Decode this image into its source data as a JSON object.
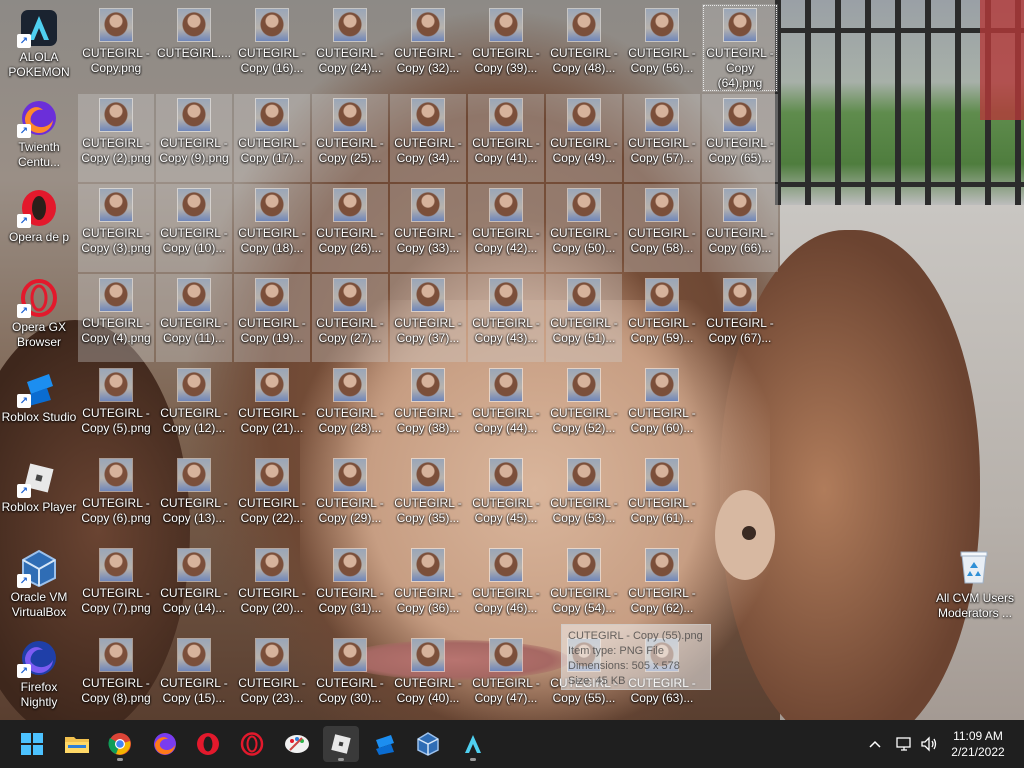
{
  "shortcuts": [
    {
      "label": "ALOLA\nPOKEMON",
      "icon": "alola-pokemon-icon"
    },
    {
      "label": "Twienth\nCentu...",
      "icon": "firefox-icon"
    },
    {
      "label": "Opera de p",
      "icon": "opera-icon"
    },
    {
      "label": "Opera GX\nBrowser",
      "icon": "opera-gx-icon"
    },
    {
      "label": "Roblox Studio",
      "icon": "roblox-studio-icon"
    },
    {
      "label": "Roblox Player",
      "icon": "roblox-player-icon"
    },
    {
      "label": "Oracle VM\nVirtualBox",
      "icon": "virtualbox-icon"
    },
    {
      "label": "Firefox\nNightly",
      "icon": "firefox-nightly-icon"
    }
  ],
  "files": [
    [
      [
        "CUTEGIRL -",
        "Copy.png"
      ],
      [
        "CUTEGIRL....",
        ""
      ],
      [
        "CUTEGIRL -",
        "Copy (16)..."
      ],
      [
        "CUTEGIRL -",
        "Copy (24)..."
      ],
      [
        "CUTEGIRL -",
        "Copy (32)..."
      ],
      [
        "CUTEGIRL -",
        "Copy (39)..."
      ],
      [
        "CUTEGIRL -",
        "Copy (48)..."
      ],
      [
        "CUTEGIRL -",
        "Copy (56)..."
      ],
      [
        "CUTEGIRL -",
        "Copy",
        "(64).png"
      ]
    ],
    [
      [
        "CUTEGIRL -",
        "Copy (2).png"
      ],
      [
        "CUTEGIRL -",
        "Copy (9).png"
      ],
      [
        "CUTEGIRL -",
        "Copy (17)..."
      ],
      [
        "CUTEGIRL -",
        "Copy (25)..."
      ],
      [
        "CUTEGIRL -",
        "Copy (34)..."
      ],
      [
        "CUTEGIRL -",
        "Copy (41)..."
      ],
      [
        "CUTEGIRL -",
        "Copy (49)..."
      ],
      [
        "CUTEGIRL -",
        "Copy (57)..."
      ],
      [
        "CUTEGIRL -",
        "Copy (65)..."
      ]
    ],
    [
      [
        "CUTEGIRL -",
        "Copy (3).png"
      ],
      [
        "CUTEGIRL -",
        "Copy (10)..."
      ],
      [
        "CUTEGIRL -",
        "Copy (18)..."
      ],
      [
        "CUTEGIRL -",
        "Copy (26)..."
      ],
      [
        "CUTEGIRL -",
        "Copy (33)..."
      ],
      [
        "CUTEGIRL -",
        "Copy (42)..."
      ],
      [
        "CUTEGIRL -",
        "Copy (50)..."
      ],
      [
        "CUTEGIRL -",
        "Copy (58)..."
      ],
      [
        "CUTEGIRL -",
        "Copy (66)..."
      ]
    ],
    [
      [
        "CUTEGIRL -",
        "Copy (4).png"
      ],
      [
        "CUTEGIRL -",
        "Copy (11)..."
      ],
      [
        "CUTEGIRL -",
        "Copy (19)..."
      ],
      [
        "CUTEGIRL -",
        "Copy (27)..."
      ],
      [
        "CUTEGIRL -",
        "Copy (37)..."
      ],
      [
        "CUTEGIRL -",
        "Copy (43)..."
      ],
      [
        "CUTEGIRL -",
        "Copy (51)..."
      ],
      [
        "CUTEGIRL -",
        "Copy (59)..."
      ],
      [
        "CUTEGIRL -",
        "Copy (67)..."
      ]
    ],
    [
      [
        "CUTEGIRL -",
        "Copy (5).png"
      ],
      [
        "CUTEGIRL -",
        "Copy (12)..."
      ],
      [
        "CUTEGIRL -",
        "Copy (21)..."
      ],
      [
        "CUTEGIRL -",
        "Copy (28)..."
      ],
      [
        "CUTEGIRL -",
        "Copy (38)..."
      ],
      [
        "CUTEGIRL -",
        "Copy (44)..."
      ],
      [
        "CUTEGIRL -",
        "Copy (52)..."
      ],
      [
        "CUTEGIRL -",
        "Copy (60)..."
      ]
    ],
    [
      [
        "CUTEGIRL -",
        "Copy (6).png"
      ],
      [
        "CUTEGIRL -",
        "Copy (13)..."
      ],
      [
        "CUTEGIRL -",
        "Copy (22)..."
      ],
      [
        "CUTEGIRL -",
        "Copy (29)..."
      ],
      [
        "CUTEGIRL -",
        "Copy (35)..."
      ],
      [
        "CUTEGIRL -",
        "Copy (45)..."
      ],
      [
        "CUTEGIRL -",
        "Copy (53)..."
      ],
      [
        "CUTEGIRL -",
        "Copy (61)..."
      ]
    ],
    [
      [
        "CUTEGIRL -",
        "Copy (7).png"
      ],
      [
        "CUTEGIRL -",
        "Copy (14)..."
      ],
      [
        "CUTEGIRL -",
        "Copy (20)..."
      ],
      [
        "CUTEGIRL -",
        "Copy (31)..."
      ],
      [
        "CUTEGIRL -",
        "Copy (36)..."
      ],
      [
        "CUTEGIRL -",
        "Copy (46)..."
      ],
      [
        "CUTEGIRL -",
        "Copy (54)..."
      ],
      [
        "CUTEGIRL -",
        "Copy (62)..."
      ]
    ],
    [
      [
        "CUTEGIRL -",
        "Copy (8).png"
      ],
      [
        "CUTEGIRL -",
        "Copy (15)..."
      ],
      [
        "CUTEGIRL -",
        "Copy (23)..."
      ],
      [
        "CUTEGIRL -",
        "Copy (30)..."
      ],
      [
        "CUTEGIRL -",
        "Copy (40)..."
      ],
      [
        "CUTEGIRL -",
        "Copy (47)..."
      ],
      [
        "CUTEGIRL -",
        "Copy (55)..."
      ],
      [
        "CUTEGIRL -",
        "Copy (63)..."
      ]
    ]
  ],
  "tooltip": {
    "name": "CUTEGIRL - Copy (55).png",
    "type": "Item type: PNG File",
    "dimensions": "Dimensions: 505 x 578",
    "size": "Size: 45 KB"
  },
  "recycle_bin": {
    "label": "All CVM Users\nModerators ..."
  },
  "taskbar": {
    "apps": [
      "start-icon",
      "file-explorer-icon",
      "chrome-icon",
      "firefox-icon",
      "opera-icon",
      "opera-gx-icon",
      "paint-icon",
      "roblox-player-icon",
      "roblox-studio-icon",
      "virtualbox-icon",
      "alola-pokemon-icon"
    ],
    "time": "11:09 AM",
    "date": "2/21/2022"
  },
  "colors": {
    "taskbar": "#1f1f1f",
    "selection": "#cdcdcd"
  }
}
